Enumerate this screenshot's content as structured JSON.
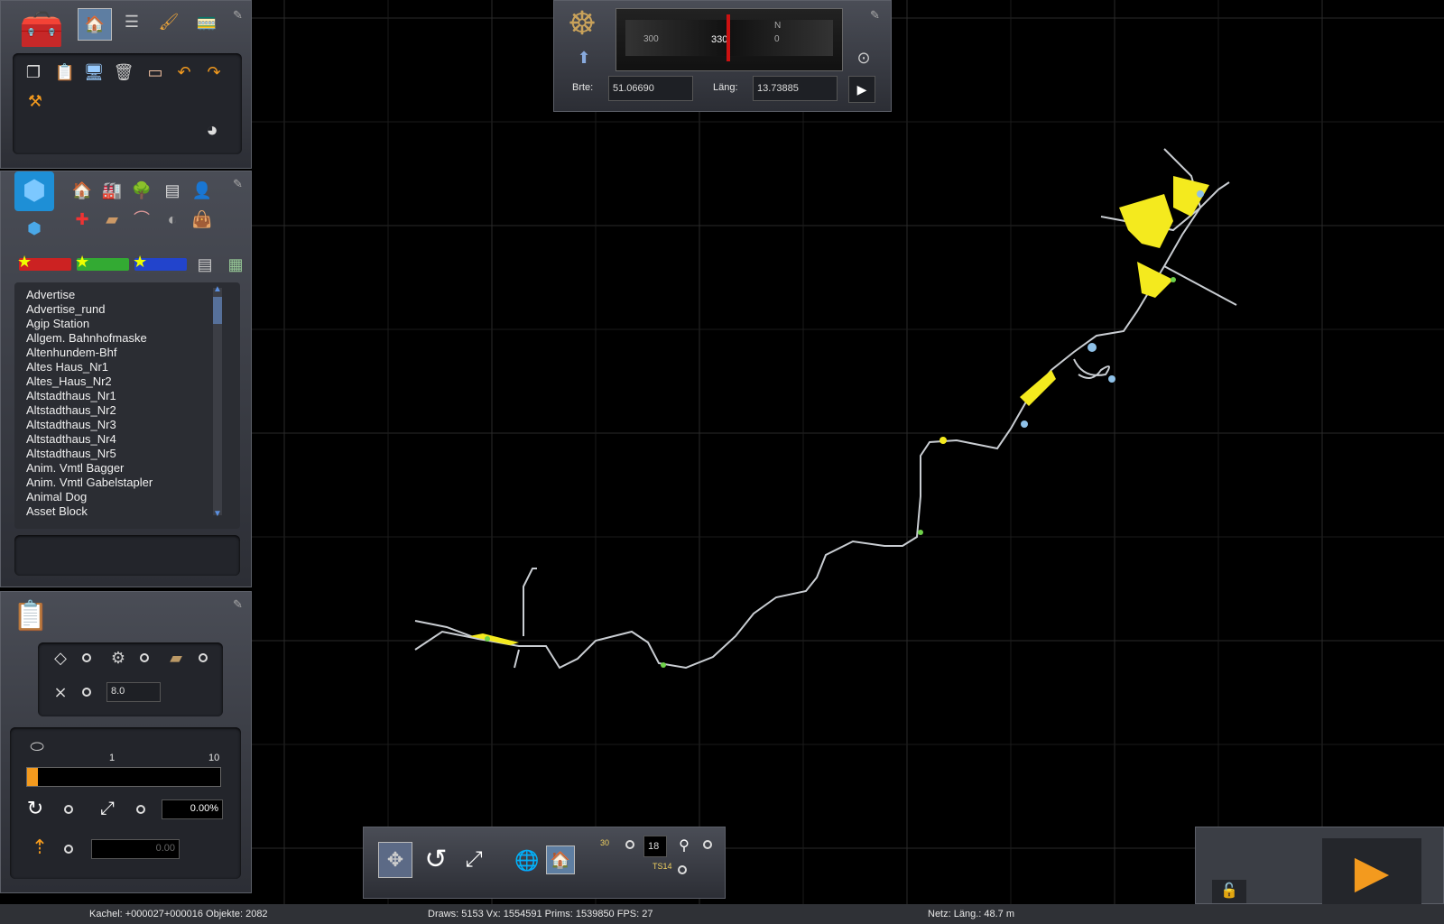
{
  "asset_list": {
    "items": [
      "Advertise",
      "Advertise_rund",
      "Agip Station",
      "Allgem. Bahnhofmaske",
      "Altenhundem-Bhf",
      "Altes Haus_Nr1",
      "Altes_Haus_Nr2",
      "Altstadthaus_Nr1",
      "Altstadthaus_Nr2",
      "Altstadthaus_Nr3",
      "Altstadthaus_Nr4",
      "Altstadthaus_Nr5",
      "Anim. Vmtl Bagger",
      "Anim. Vmtl Gabelstapler",
      "Animal Dog",
      "Asset Block"
    ]
  },
  "compass": {
    "ticks": [
      "300",
      "330",
      "0"
    ],
    "north_label": "N",
    "lat_label": "Brte:",
    "lat_value": "51.06690",
    "lon_label": "Läng:",
    "lon_value": "13.73885"
  },
  "height_tool": {
    "height_value": "8.0",
    "scale_min": "1",
    "scale_max": "10",
    "percent_value": "0.00%",
    "offset_value": "0.00"
  },
  "bottom_toolbar": {
    "view_distance_value": "18",
    "label_30": "30",
    "label_ts14": "TS14"
  },
  "status": {
    "tile": "Kachel: +000027+000016  Objekte: 2082",
    "stats": "Draws: 5153 Vx: 1554591 Prims: 1539850 FPS: 27",
    "net": "Netz:  Läng.:   48.7 m"
  },
  "colors": {
    "track": "#c9cdd2",
    "highlight_yellow": "#f4ea1e",
    "highlight_blue": "#8fc1e8",
    "highlight_green": "#6fd24a",
    "accent_orange": "#f39a1e"
  }
}
